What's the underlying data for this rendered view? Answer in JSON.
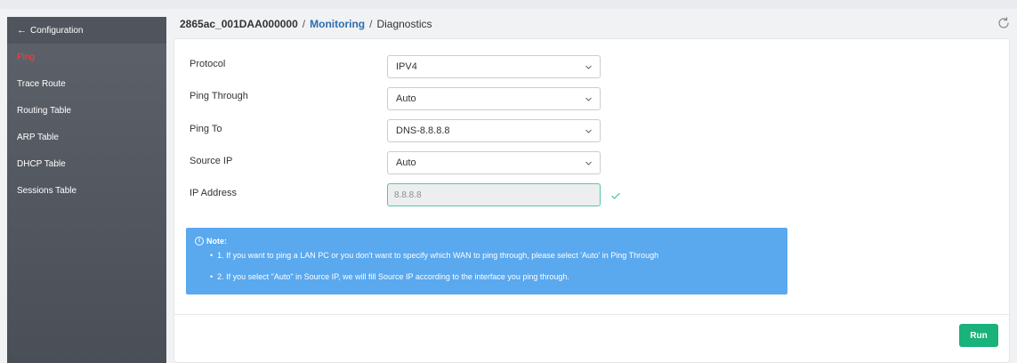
{
  "header": {
    "device": "2865ac_001DAA000000",
    "separator": "/",
    "section": "Monitoring",
    "page": "Diagnostics"
  },
  "sidebar": {
    "back_label": "Configuration",
    "items": [
      {
        "label": "Ping",
        "active": true
      },
      {
        "label": "Trace Route"
      },
      {
        "label": "Routing Table"
      },
      {
        "label": "ARP Table"
      },
      {
        "label": "DHCP Table"
      },
      {
        "label": "Sessions Table"
      }
    ]
  },
  "form": {
    "protocol": {
      "label": "Protocol",
      "value": "IPV4"
    },
    "ping_through": {
      "label": "Ping Through",
      "value": "Auto"
    },
    "ping_to": {
      "label": "Ping To",
      "value": "DNS-8.8.8.8"
    },
    "source_ip": {
      "label": "Source IP",
      "value": "Auto"
    },
    "ip_address": {
      "label": "IP Address",
      "value": "8.8.8.8"
    }
  },
  "note": {
    "title": "Note:",
    "lines": [
      "1. If you want to ping a LAN PC or you don't want to specify which WAN to ping through, please select 'Auto' in Ping Through",
      "2. If you select \"Auto\" in Source IP, we will fill Source IP according to the interface you ping through."
    ]
  },
  "actions": {
    "run_label": "Run"
  },
  "colors": {
    "sidebar_bg": "#53585f",
    "active_item": "#ff3b3b",
    "section_link": "#2a6fb0",
    "note_bg": "#5aa8ee",
    "run_button": "#19b27b",
    "valid": "#5ac5a4"
  }
}
